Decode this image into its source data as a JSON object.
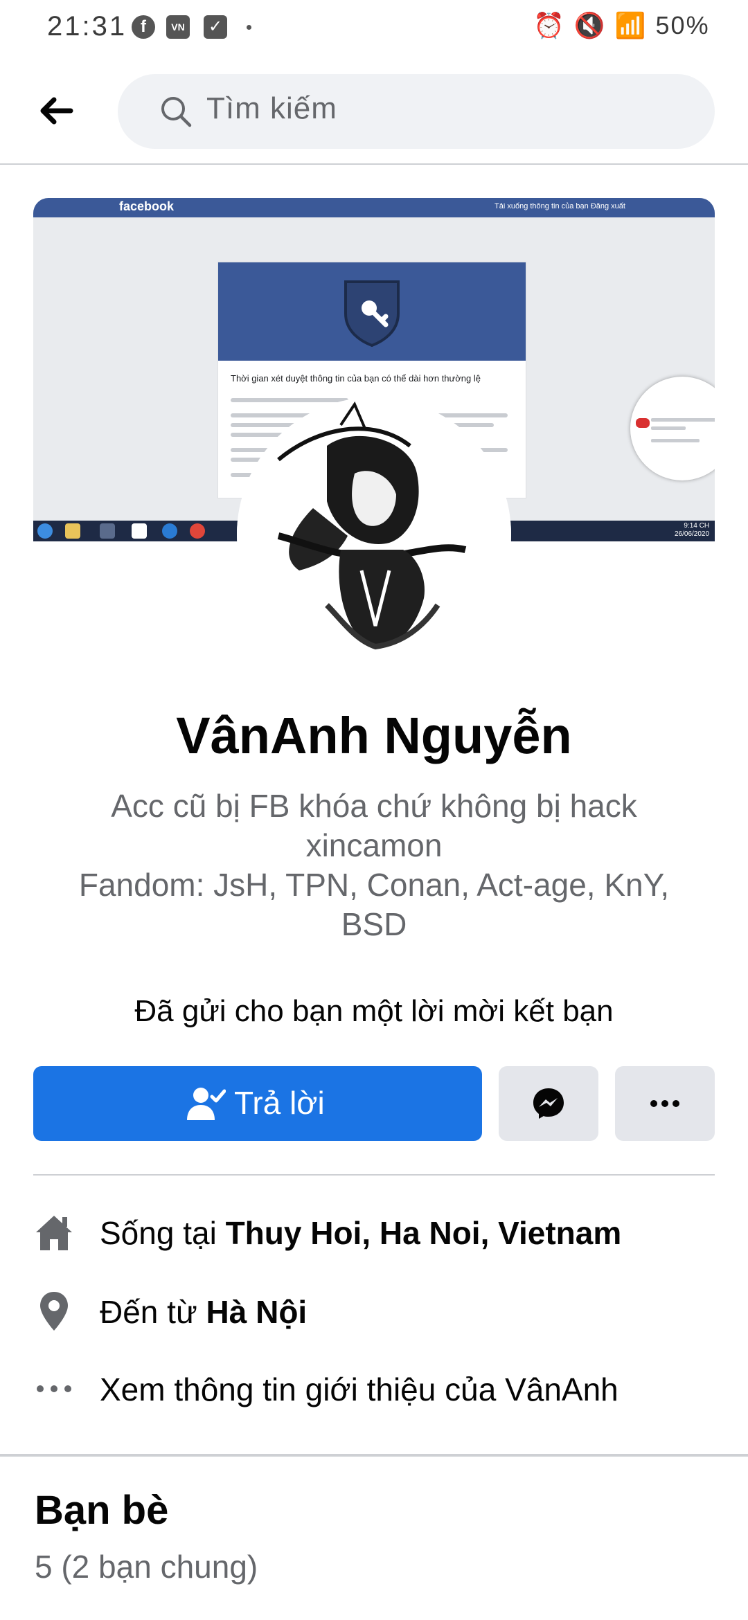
{
  "status_bar": {
    "time": "21:31",
    "left_icons": [
      "facebook-icon",
      "news-app-icon",
      "checkbox-app-icon"
    ],
    "battery": "50%"
  },
  "search": {
    "placeholder": "Tìm kiếm"
  },
  "cover_screenshot": {
    "brand": "facebook",
    "top_links": "Tải xuống thông tin của bạn   Đăng xuất",
    "dialog_title": "Thời gian xét duyệt thông tin của bạn có thể dài hơn thường lệ",
    "clock_time": "9:14 CH",
    "clock_date": "26/06/2020"
  },
  "profile": {
    "name": "VânAnh Nguyễn",
    "bio_lines": [
      "Acc cũ bị FB khóa chứ không bị hack",
      "xincamon",
      "Fandom: JsH, TPN, Conan, Act-age, KnY,",
      "BSD"
    ],
    "friend_request_text": "Đã gửi cho bạn một lời mời kết bạn"
  },
  "actions": {
    "reply_label": "Trả lời",
    "messenger_icon": "messenger-icon",
    "more_icon": "more-icon"
  },
  "details": [
    {
      "icon": "home-icon",
      "prefix": "Sống tại ",
      "value": "Thuy Hoi, Ha Noi, Vietnam"
    },
    {
      "icon": "location-pin-icon",
      "prefix": "Đến từ ",
      "value": "Hà Nội"
    },
    {
      "icon": "ellipsis-icon",
      "prefix": "Xem thông tin giới thiệu của VânAnh",
      "value": ""
    }
  ],
  "friends": {
    "title": "Bạn bè",
    "count": "5 (2 bạn chung)"
  },
  "colors": {
    "accent": "#1b74e4",
    "secondary_button": "#e4e6eb",
    "search_bg": "#f0f2f5",
    "muted_text": "#65676b"
  }
}
